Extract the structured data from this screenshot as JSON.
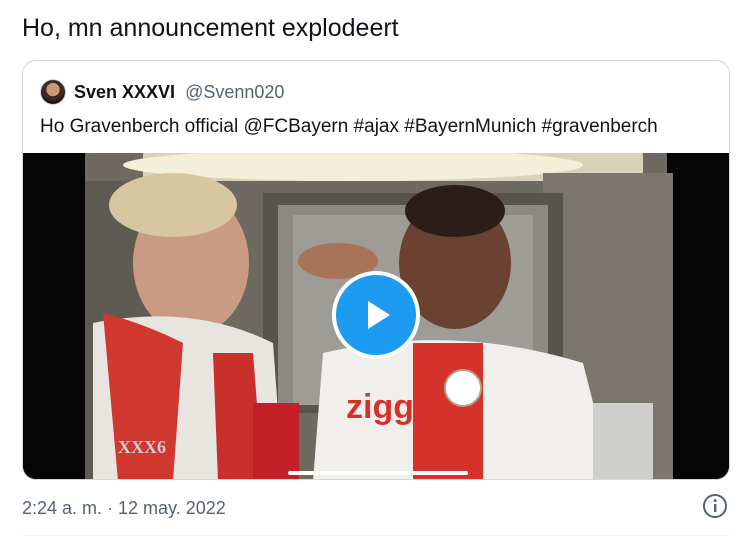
{
  "tweet": {
    "text": "Ho, mn announcement explodeert",
    "timestamp": "2:24 a. m. · 12 may. 2022"
  },
  "quoted_tweet": {
    "display_name": "Sven XXXVI",
    "handle": "@Svenn020",
    "text": "Ho Gravenberch official @FCBayern #ajax #BayernMunich #gravenberch",
    "media": {
      "type": "video",
      "watermark": "XXX6",
      "shirt_sponsor": "ziggo",
      "progress_fraction": 0.0
    }
  },
  "icons": {
    "play": "play-icon",
    "info": "info-icon"
  },
  "colors": {
    "accent": "#1d9bf0",
    "text_primary": "#0f1419",
    "text_secondary": "#536471",
    "border": "#cfd9de"
  }
}
